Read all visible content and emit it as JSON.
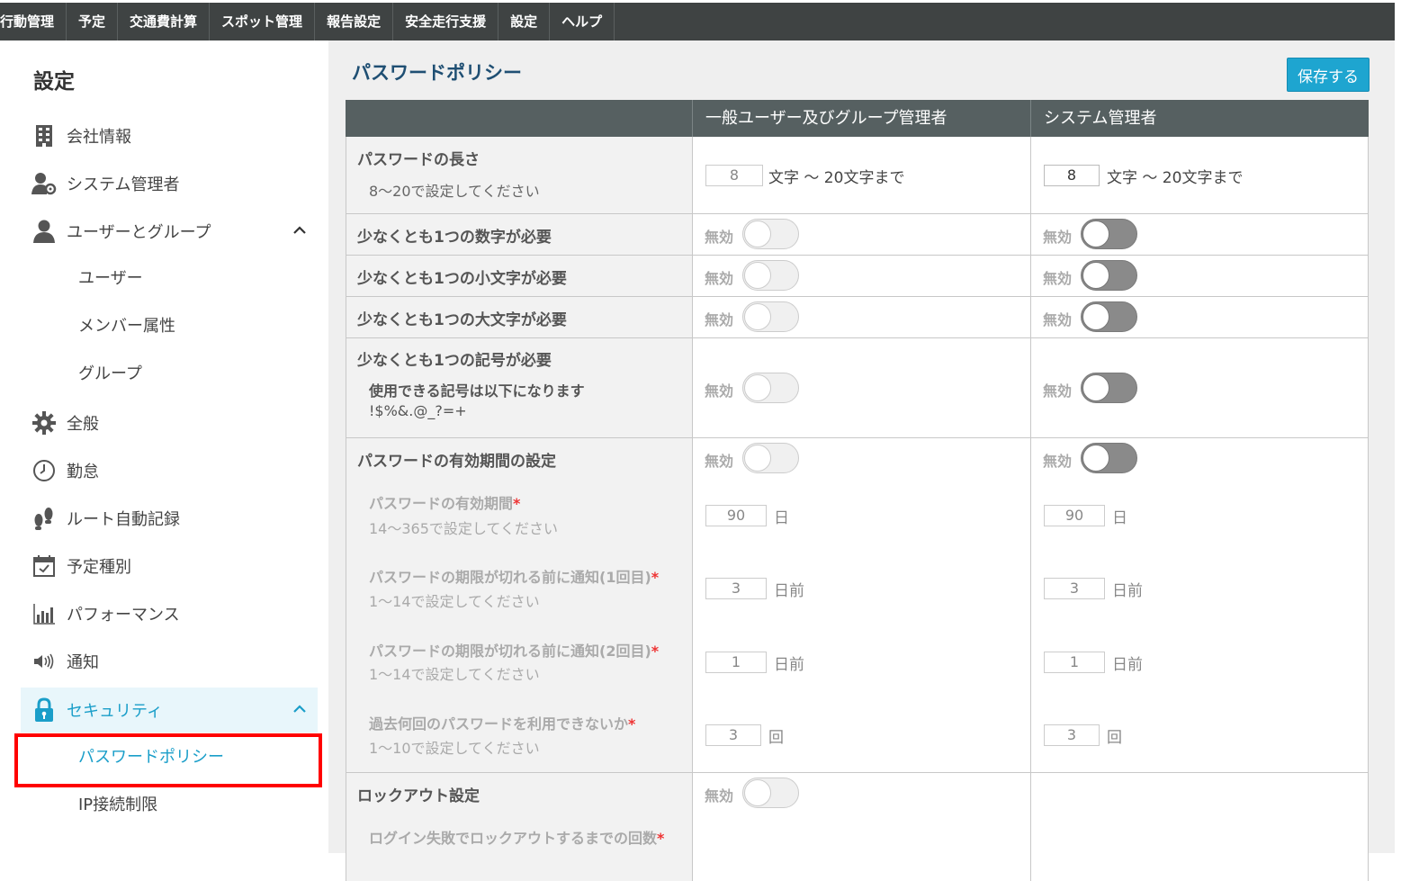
{
  "topnav": [
    "行動管理",
    "予定",
    "交通費計算",
    "スポット管理",
    "報告設定",
    "安全走行支援",
    "設定",
    "ヘルプ"
  ],
  "sidebar": {
    "title": "設定",
    "items": [
      {
        "label": "会社情報",
        "icon": "building-icon"
      },
      {
        "label": "システム管理者",
        "icon": "admin-icon"
      },
      {
        "label": "ユーザーとグループ",
        "icon": "user-icon"
      },
      {
        "label": "全般",
        "icon": "gear-icon"
      },
      {
        "label": "勤怠",
        "icon": "clock-icon"
      },
      {
        "label": "ルート自動記録",
        "icon": "footprint-icon"
      },
      {
        "label": "予定種別",
        "icon": "calendar-icon"
      },
      {
        "label": "パフォーマンス",
        "icon": "chart-icon"
      },
      {
        "label": "通知",
        "icon": "speaker-icon"
      },
      {
        "label": "セキュリティ",
        "icon": "lock-icon"
      }
    ],
    "user_group_sub": [
      "ユーザー",
      "メンバー属性",
      "グループ"
    ],
    "security_sub": [
      "パスワードポリシー",
      "IP接続制限"
    ]
  },
  "main": {
    "title": "パスワードポリシー",
    "save_label": "保存する",
    "col_general": "一般ユーザー及びグループ管理者",
    "col_admin": "システム管理者",
    "disabled_label": "無効",
    "length": {
      "label": "パスワードの長さ",
      "hint": "8〜20で設定してください",
      "general_value": "8",
      "admin_value": "8",
      "unit": "文字 〜 20文字まで"
    },
    "rule_digit": "少なくとも1つの数字が必要",
    "rule_lower": "少なくとも1つの小文字が必要",
    "rule_upper": "少なくとも1つの大文字が必要",
    "rule_symbol": "少なくとも1つの記号が必要",
    "symbol_hint": "使用できる記号は以下になります",
    "symbol_list": "!$%&.@_?=+",
    "expiry": {
      "label": "パスワードの有効期間の設定",
      "period_label": "パスワードの有効期間",
      "period_hint": "14〜365で設定してください",
      "period_value": "90",
      "period_unit": "日",
      "notify1_label": "パスワードの期限が切れる前に通知(1回目)",
      "notify1_hint": "1〜14で設定してください",
      "notify1_value": "3",
      "notify2_label": "パスワードの期限が切れる前に通知(2回目)",
      "notify2_hint": "1〜14で設定してください",
      "notify2_value": "1",
      "notify_unit": "日前",
      "history_label": "過去何回のパスワードを利用できないか",
      "history_hint": "1〜10で設定してください",
      "history_value": "3",
      "history_unit": "回",
      "required_mark": "*"
    },
    "lockout": {
      "label": "ロックアウト設定",
      "attempts_label": "ログイン失敗でロックアウトするまでの回数"
    }
  },
  "colors": {
    "topnav": "#3f4343",
    "table_header": "#566061",
    "accent": "#1ea5d0",
    "title": "#1f4f73"
  }
}
